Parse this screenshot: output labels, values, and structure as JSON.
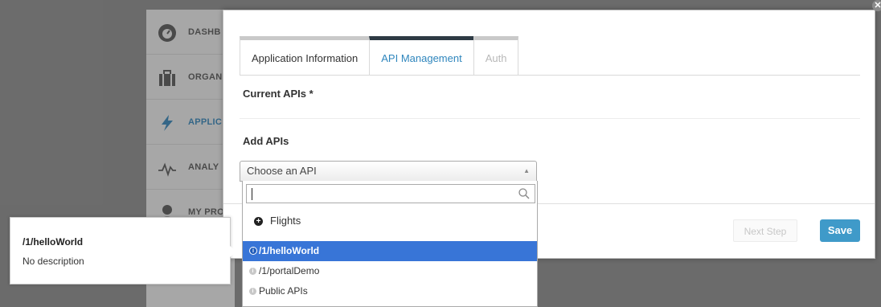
{
  "sidebar": {
    "items": [
      {
        "label": "DASHB",
        "icon": "dashboard-icon"
      },
      {
        "label": "ORGAN",
        "icon": "briefcase-icon"
      },
      {
        "label": "APPLIC",
        "icon": "lightning-icon"
      },
      {
        "label": "ANALY",
        "icon": "pulse-icon"
      },
      {
        "label": "MY PRO",
        "icon": "user-icon"
      }
    ]
  },
  "modal": {
    "tabs": [
      {
        "label": "Application Information"
      },
      {
        "label": "API Management"
      },
      {
        "label": "Auth"
      }
    ],
    "current_apis_label": "Current APIs *",
    "add_apis_label": "Add APIs",
    "select": {
      "placeholder": "Choose an API"
    },
    "dropdown": {
      "search_value": "",
      "group_label": "Flights",
      "options": [
        {
          "label": "/1/helloWorld"
        },
        {
          "label": "/1/portalDemo"
        },
        {
          "label": "Public APIs"
        }
      ]
    },
    "next_button": "Next Step",
    "save_button": "Save",
    "close_glyph": "✕"
  },
  "tooltip": {
    "title": "/1/helloWorld",
    "description": "No description"
  },
  "colors": {
    "accent": "#2f86bd",
    "save": "#3f9ac9",
    "highlight": "#3875d7"
  }
}
